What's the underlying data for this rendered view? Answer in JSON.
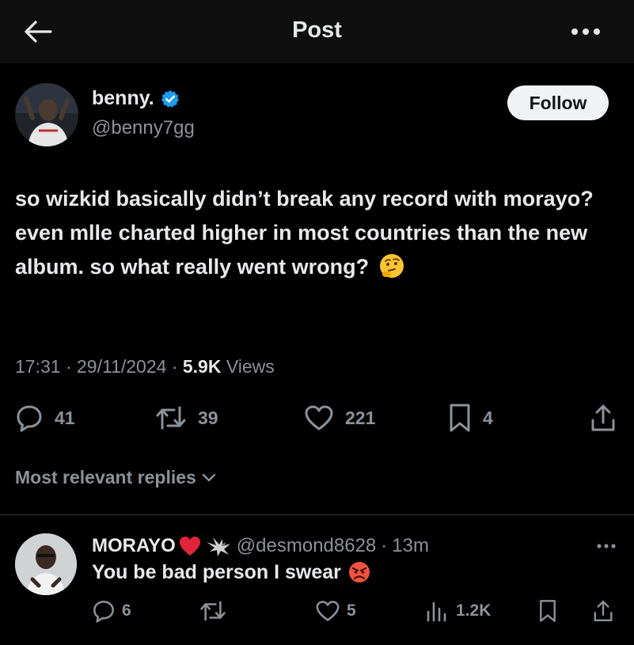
{
  "header": {
    "title": "Post",
    "back_icon": "arrow-left-icon",
    "more_icon": "more-horizontal-icon"
  },
  "author": {
    "name": "benny.",
    "handle": "@benny7gg",
    "verified": true,
    "follow_label": "Follow"
  },
  "tweet": {
    "text": "so wizkid basically didn’t break any record with morayo? even mlle charted higher in most countries than the new album. so what really went wrong?",
    "emoji": "thinking-face-emoji",
    "time": "17:31",
    "date": "29/11/2024",
    "views_count": "5.9K",
    "views_label": "Views",
    "separator": "·"
  },
  "actions": {
    "replies": "41",
    "reposts": "39",
    "likes": "221",
    "bookmarks": "4"
  },
  "replies_filter": {
    "label": "Most relevant replies"
  },
  "reply": {
    "name": "MORAYO",
    "handle": "@desmond8628",
    "separator": "·",
    "time": "13m",
    "text": "You be bad person I swear",
    "emoji": "angry-face-emoji",
    "actions": {
      "replies": "6",
      "likes": "5",
      "views": "1.2K"
    }
  },
  "colors": {
    "background": "#000000",
    "header": "#0f0f0f",
    "text": "#e7e9ea",
    "muted": "#8b9299",
    "verified": "#1d9bf0",
    "divider": "#2f3336",
    "follow_bg": "#eff3f4"
  }
}
